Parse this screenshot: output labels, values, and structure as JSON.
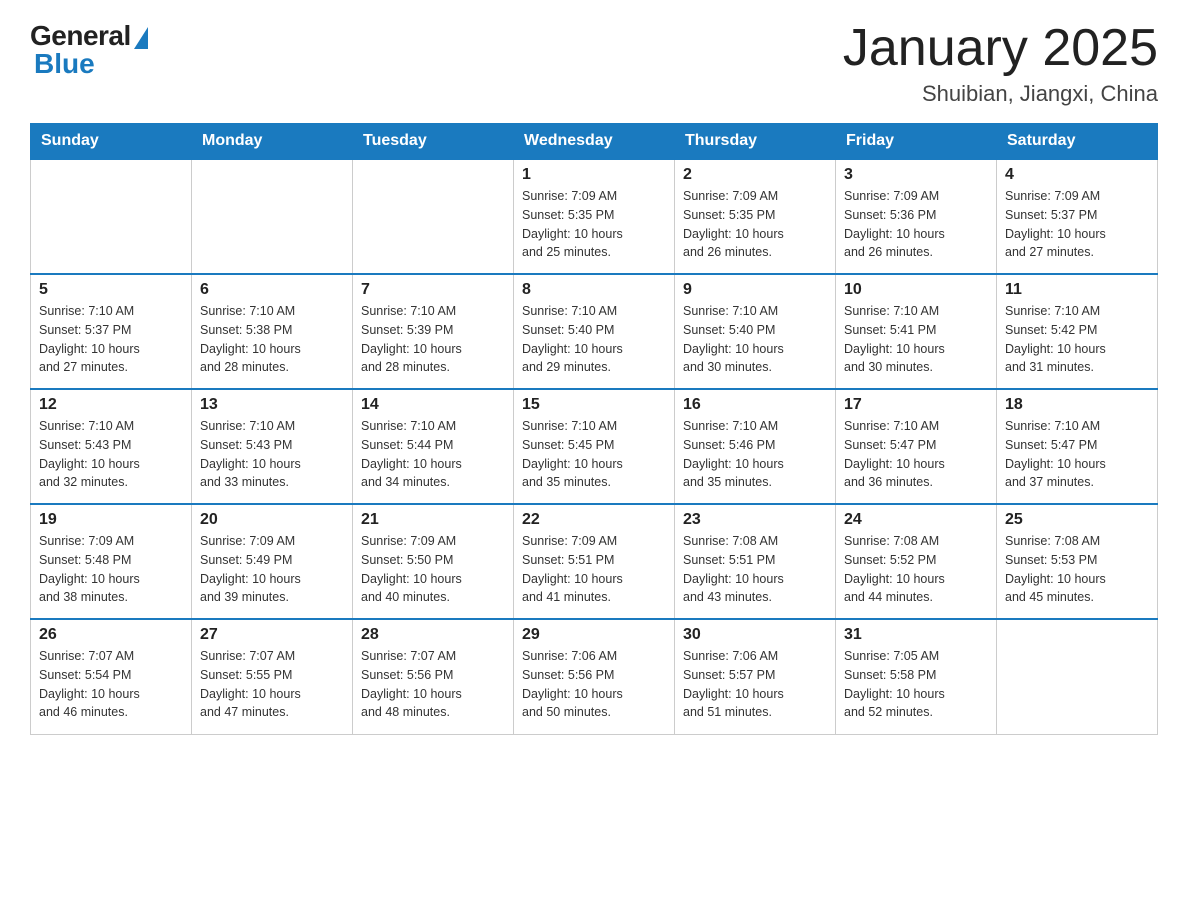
{
  "logo": {
    "general": "General",
    "blue": "Blue"
  },
  "title": "January 2025",
  "subtitle": "Shuibian, Jiangxi, China",
  "days_of_week": [
    "Sunday",
    "Monday",
    "Tuesday",
    "Wednesday",
    "Thursday",
    "Friday",
    "Saturday"
  ],
  "weeks": [
    [
      {
        "day": "",
        "info": ""
      },
      {
        "day": "",
        "info": ""
      },
      {
        "day": "",
        "info": ""
      },
      {
        "day": "1",
        "info": "Sunrise: 7:09 AM\nSunset: 5:35 PM\nDaylight: 10 hours\nand 25 minutes."
      },
      {
        "day": "2",
        "info": "Sunrise: 7:09 AM\nSunset: 5:35 PM\nDaylight: 10 hours\nand 26 minutes."
      },
      {
        "day": "3",
        "info": "Sunrise: 7:09 AM\nSunset: 5:36 PM\nDaylight: 10 hours\nand 26 minutes."
      },
      {
        "day": "4",
        "info": "Sunrise: 7:09 AM\nSunset: 5:37 PM\nDaylight: 10 hours\nand 27 minutes."
      }
    ],
    [
      {
        "day": "5",
        "info": "Sunrise: 7:10 AM\nSunset: 5:37 PM\nDaylight: 10 hours\nand 27 minutes."
      },
      {
        "day": "6",
        "info": "Sunrise: 7:10 AM\nSunset: 5:38 PM\nDaylight: 10 hours\nand 28 minutes."
      },
      {
        "day": "7",
        "info": "Sunrise: 7:10 AM\nSunset: 5:39 PM\nDaylight: 10 hours\nand 28 minutes."
      },
      {
        "day": "8",
        "info": "Sunrise: 7:10 AM\nSunset: 5:40 PM\nDaylight: 10 hours\nand 29 minutes."
      },
      {
        "day": "9",
        "info": "Sunrise: 7:10 AM\nSunset: 5:40 PM\nDaylight: 10 hours\nand 30 minutes."
      },
      {
        "day": "10",
        "info": "Sunrise: 7:10 AM\nSunset: 5:41 PM\nDaylight: 10 hours\nand 30 minutes."
      },
      {
        "day": "11",
        "info": "Sunrise: 7:10 AM\nSunset: 5:42 PM\nDaylight: 10 hours\nand 31 minutes."
      }
    ],
    [
      {
        "day": "12",
        "info": "Sunrise: 7:10 AM\nSunset: 5:43 PM\nDaylight: 10 hours\nand 32 minutes."
      },
      {
        "day": "13",
        "info": "Sunrise: 7:10 AM\nSunset: 5:43 PM\nDaylight: 10 hours\nand 33 minutes."
      },
      {
        "day": "14",
        "info": "Sunrise: 7:10 AM\nSunset: 5:44 PM\nDaylight: 10 hours\nand 34 minutes."
      },
      {
        "day": "15",
        "info": "Sunrise: 7:10 AM\nSunset: 5:45 PM\nDaylight: 10 hours\nand 35 minutes."
      },
      {
        "day": "16",
        "info": "Sunrise: 7:10 AM\nSunset: 5:46 PM\nDaylight: 10 hours\nand 35 minutes."
      },
      {
        "day": "17",
        "info": "Sunrise: 7:10 AM\nSunset: 5:47 PM\nDaylight: 10 hours\nand 36 minutes."
      },
      {
        "day": "18",
        "info": "Sunrise: 7:10 AM\nSunset: 5:47 PM\nDaylight: 10 hours\nand 37 minutes."
      }
    ],
    [
      {
        "day": "19",
        "info": "Sunrise: 7:09 AM\nSunset: 5:48 PM\nDaylight: 10 hours\nand 38 minutes."
      },
      {
        "day": "20",
        "info": "Sunrise: 7:09 AM\nSunset: 5:49 PM\nDaylight: 10 hours\nand 39 minutes."
      },
      {
        "day": "21",
        "info": "Sunrise: 7:09 AM\nSunset: 5:50 PM\nDaylight: 10 hours\nand 40 minutes."
      },
      {
        "day": "22",
        "info": "Sunrise: 7:09 AM\nSunset: 5:51 PM\nDaylight: 10 hours\nand 41 minutes."
      },
      {
        "day": "23",
        "info": "Sunrise: 7:08 AM\nSunset: 5:51 PM\nDaylight: 10 hours\nand 43 minutes."
      },
      {
        "day": "24",
        "info": "Sunrise: 7:08 AM\nSunset: 5:52 PM\nDaylight: 10 hours\nand 44 minutes."
      },
      {
        "day": "25",
        "info": "Sunrise: 7:08 AM\nSunset: 5:53 PM\nDaylight: 10 hours\nand 45 minutes."
      }
    ],
    [
      {
        "day": "26",
        "info": "Sunrise: 7:07 AM\nSunset: 5:54 PM\nDaylight: 10 hours\nand 46 minutes."
      },
      {
        "day": "27",
        "info": "Sunrise: 7:07 AM\nSunset: 5:55 PM\nDaylight: 10 hours\nand 47 minutes."
      },
      {
        "day": "28",
        "info": "Sunrise: 7:07 AM\nSunset: 5:56 PM\nDaylight: 10 hours\nand 48 minutes."
      },
      {
        "day": "29",
        "info": "Sunrise: 7:06 AM\nSunset: 5:56 PM\nDaylight: 10 hours\nand 50 minutes."
      },
      {
        "day": "30",
        "info": "Sunrise: 7:06 AM\nSunset: 5:57 PM\nDaylight: 10 hours\nand 51 minutes."
      },
      {
        "day": "31",
        "info": "Sunrise: 7:05 AM\nSunset: 5:58 PM\nDaylight: 10 hours\nand 52 minutes."
      },
      {
        "day": "",
        "info": ""
      }
    ]
  ]
}
